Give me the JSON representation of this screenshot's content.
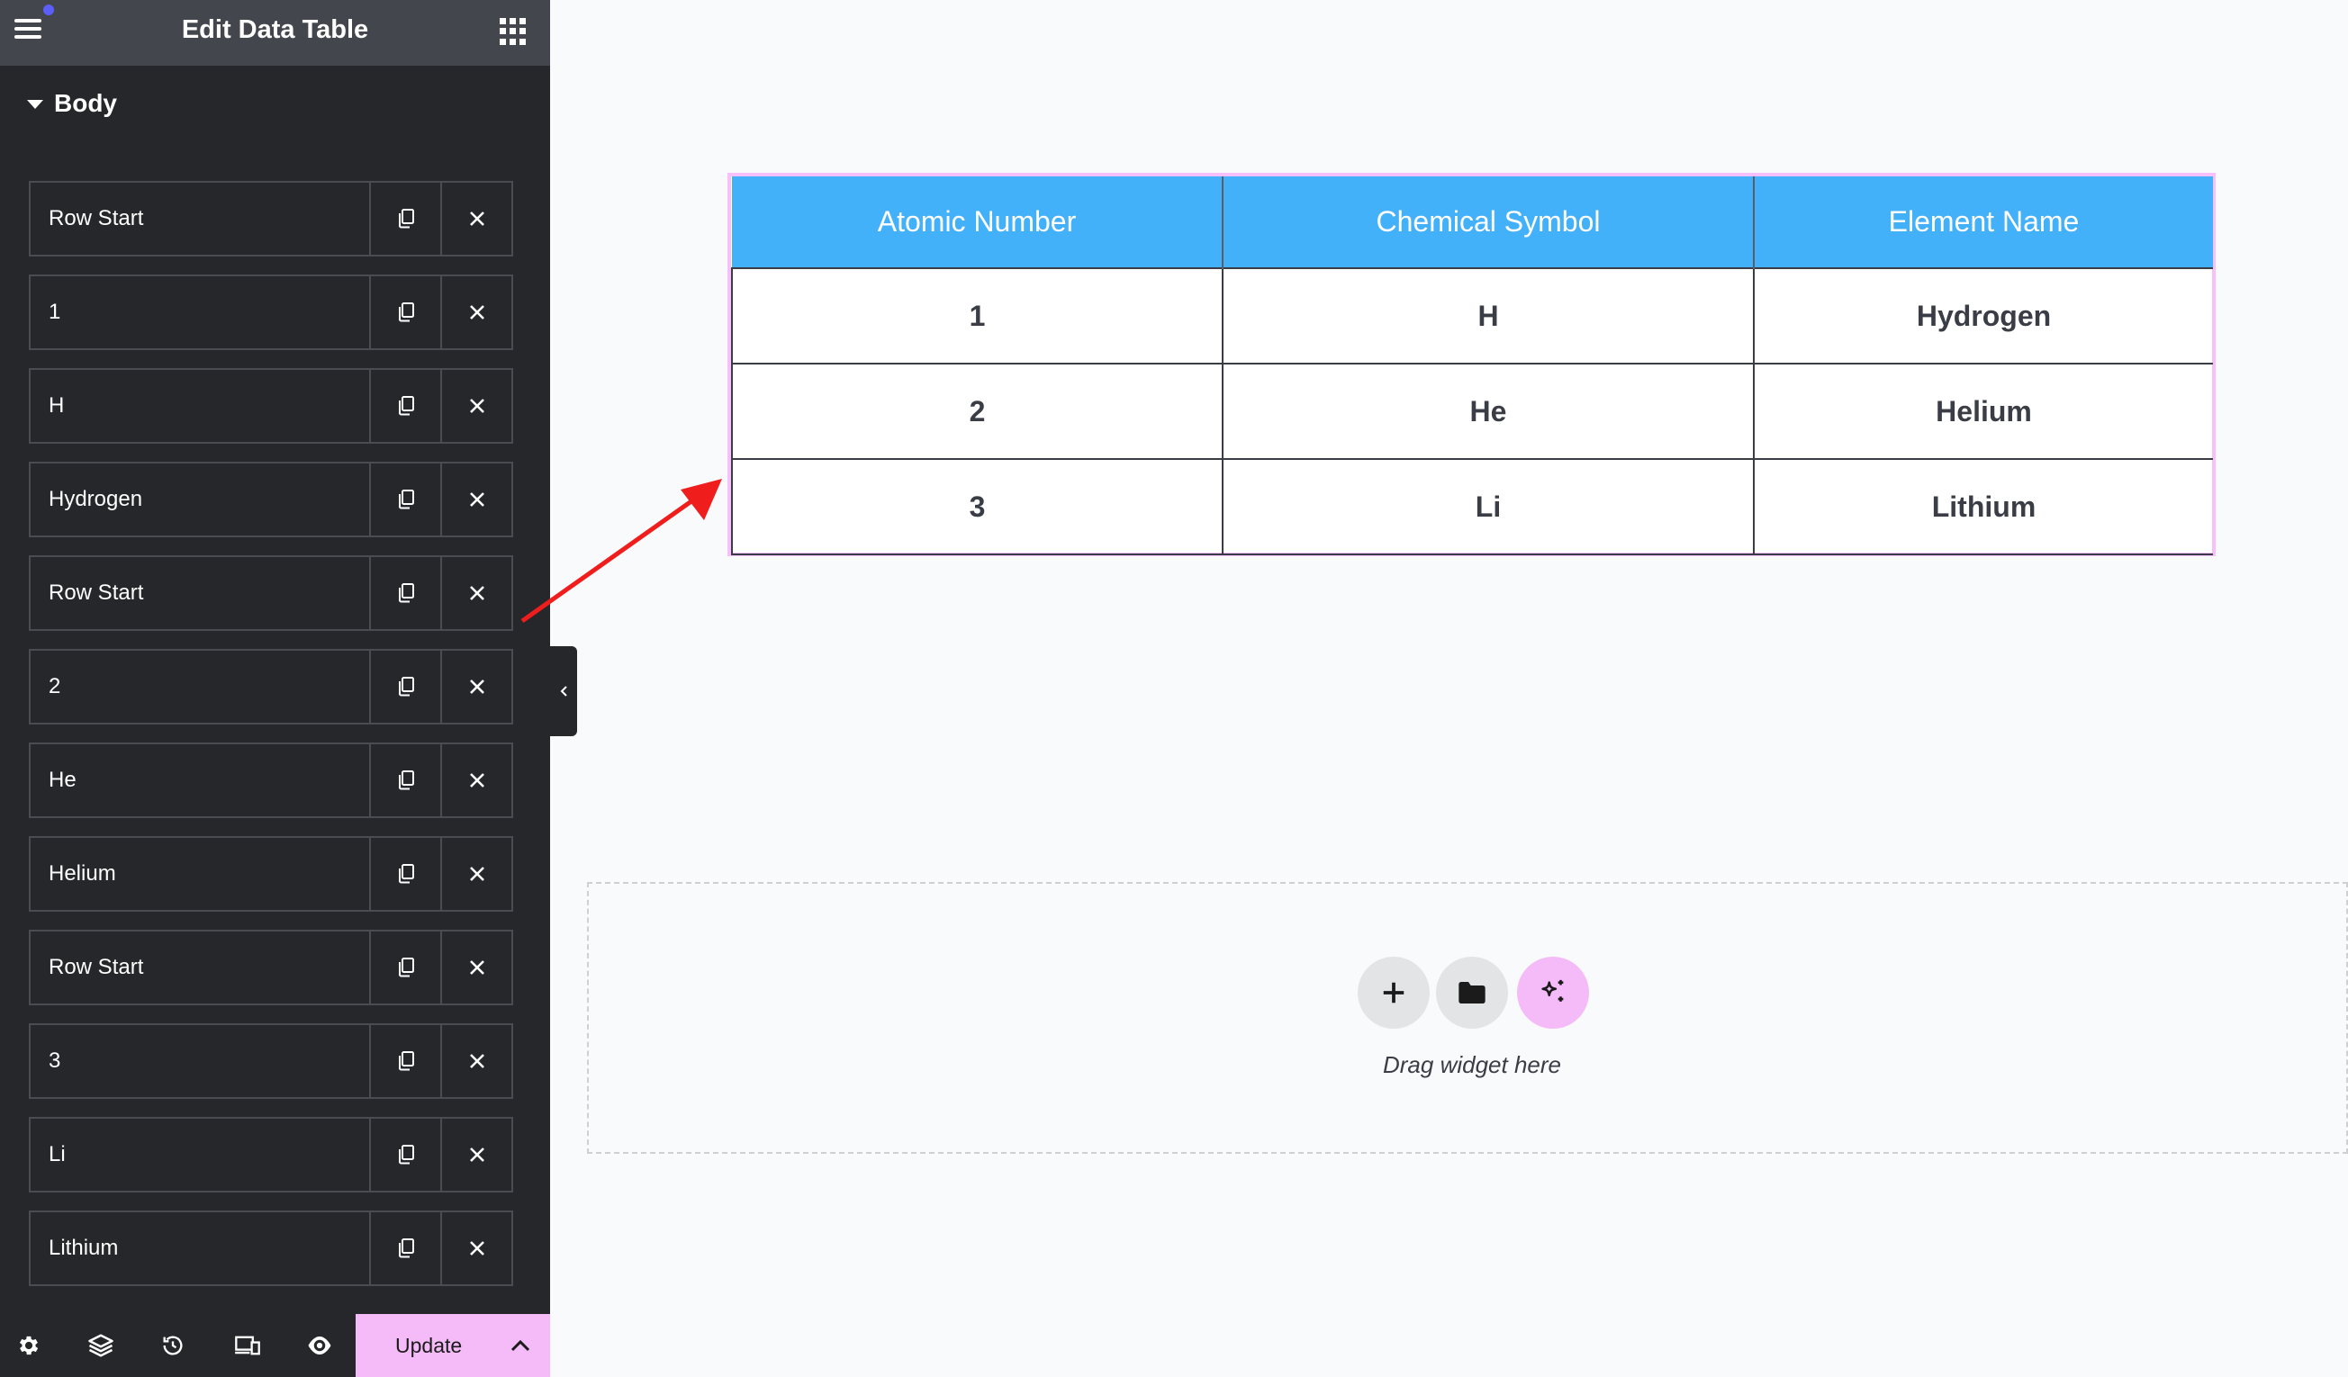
{
  "panel": {
    "title": "Edit Data Table",
    "section_label": "Body"
  },
  "body_items": [
    {
      "label": "Row Start"
    },
    {
      "label": "1"
    },
    {
      "label": "H"
    },
    {
      "label": "Hydrogen"
    },
    {
      "label": "Row Start"
    },
    {
      "label": "2"
    },
    {
      "label": "He"
    },
    {
      "label": "Helium"
    },
    {
      "label": "Row Start"
    },
    {
      "label": "3"
    },
    {
      "label": "Li"
    },
    {
      "label": "Lithium"
    }
  ],
  "item_icons": {
    "duplicate": "copy-icon",
    "remove": "close-icon"
  },
  "footer": {
    "icons": [
      "settings-gear-icon",
      "layers-icon",
      "history-icon",
      "responsive-icon",
      "preview-eye-icon"
    ],
    "update_label": "Update"
  },
  "table": {
    "headers": [
      "Atomic Number",
      "Chemical Symbol",
      "Element Name"
    ],
    "rows": [
      [
        "1",
        "H",
        "Hydrogen"
      ],
      [
        "2",
        "He",
        "Helium"
      ],
      [
        "3",
        "Li",
        "Lithium"
      ]
    ]
  },
  "drop_zone": {
    "hint": "Drag widget here",
    "buttons": [
      "add-plus-icon",
      "folder-icon",
      "ai-sparkle-icon"
    ]
  },
  "colors": {
    "sidebar_bg": "#26272b",
    "topbar_bg": "#43464d",
    "accent_pink": "#f5bbf8",
    "table_header_bg": "#43b0fa",
    "arrow_red": "#f01d1d"
  }
}
